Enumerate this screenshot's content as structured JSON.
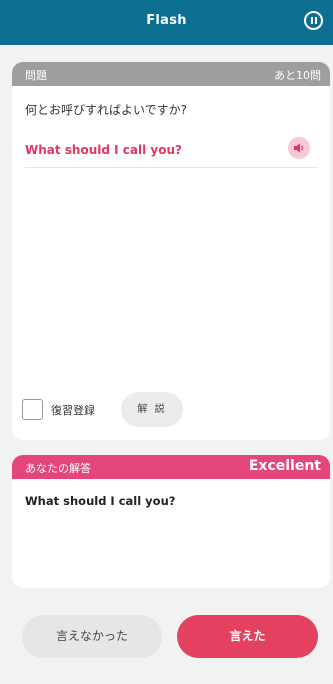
{
  "header": {
    "title": "Flash"
  },
  "question_card": {
    "label": "問題",
    "remaining": "あと10問",
    "question_ja": "何とお呼びすればよいですか?",
    "question_en": "What should I call you?",
    "review_label": "復習登録",
    "explain_label": "解 説"
  },
  "answer_card": {
    "label": "あなたの解答",
    "rating": "Excellent",
    "answer": "What should I call you?"
  },
  "buttons": {
    "fail_label": "言えなかった",
    "ok_label": "言えた"
  },
  "colors": {
    "header": "#0c6f92",
    "accent": "#e4405f",
    "answer_header": "#e5467a",
    "question_header": "#9e9e9e"
  },
  "icons": [
    "pause-icon",
    "speaker-icon",
    "checkbox-icon"
  ]
}
